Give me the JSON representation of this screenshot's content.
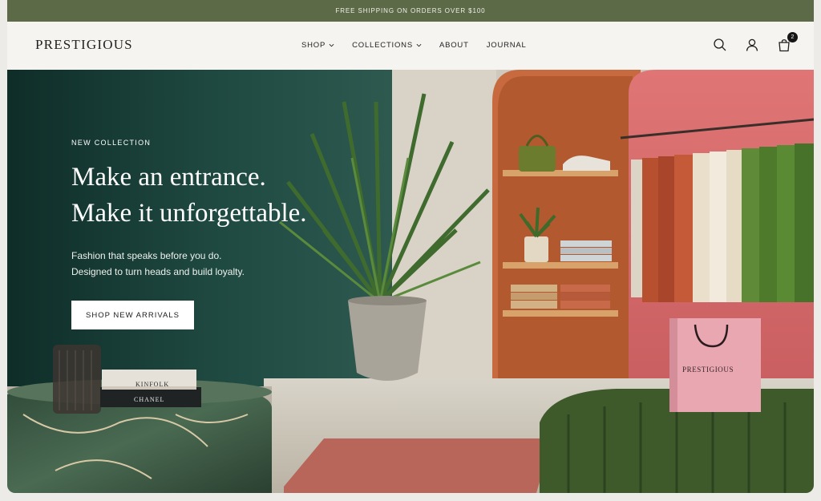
{
  "announcement": "FREE SHIPPING ON ORDERS OVER $100",
  "brand": "PRESTIGIOUS",
  "nav": {
    "shop": "SHOP",
    "collections": "COLLECTIONS",
    "about": "ABOUT",
    "journal": "JOURNAL"
  },
  "cart": {
    "count": "2"
  },
  "hero": {
    "eyebrow": "NEW COLLECTION",
    "headline_line1": "Make an entrance.",
    "headline_line2": "Make it unforgettable.",
    "sub_line1": "Fashion that speaks before you do.",
    "sub_line2": "Designed to turn heads and build loyalty.",
    "cta": "SHOP NEW ARRIVALS"
  },
  "props": {
    "book_top": "KINFOLK",
    "book_bottom": "CHANEL",
    "bag_brand": "PRESTIGIOUS"
  },
  "colors": {
    "announcement_bg": "#5d6a48",
    "hero_wall": "#153c35",
    "pink_wall": "#d9676a",
    "ottoman": "#3e5a2b"
  },
  "icons": [
    "search-icon",
    "account-icon",
    "cart-icon",
    "chevron-down-icon"
  ]
}
